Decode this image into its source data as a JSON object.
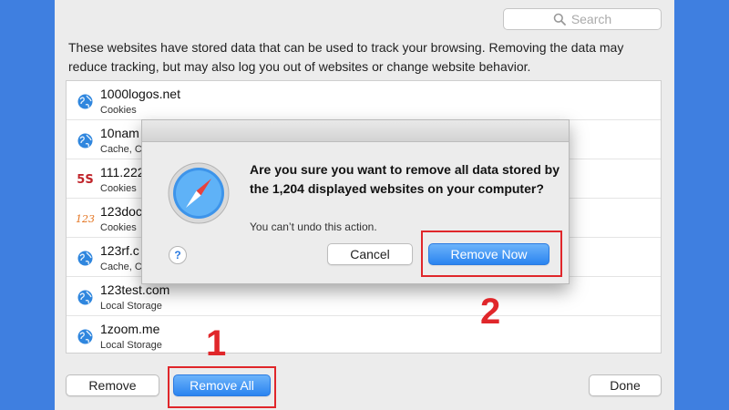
{
  "search": {
    "placeholder": "Search",
    "icon": "search-icon"
  },
  "description": "These websites have stored data that can be used to track your browsing. Removing the data may reduce tracking, but may also log you out of websites or change website behavior.",
  "websites": [
    {
      "name": "1000logos.net",
      "detail": "Cookies",
      "icon": "globe-icon"
    },
    {
      "name": "10nam",
      "detail": "Cache, C",
      "icon": "globe-icon"
    },
    {
      "name": "111.222",
      "detail": "Cookies",
      "icon": "5s-site-icon"
    },
    {
      "name": "123doc",
      "detail": "Cookies",
      "icon": "123-site-icon"
    },
    {
      "name": "123rf.c",
      "detail": "Cache, C",
      "icon": "globe-icon"
    },
    {
      "name": "123test.com",
      "detail": "Local Storage",
      "icon": "globe-icon"
    },
    {
      "name": "1zoom.me",
      "detail": "Local Storage",
      "icon": "globe-icon"
    }
  ],
  "site_icon_text": {
    "five_s": "5S",
    "one_two_three": "123"
  },
  "buttons": {
    "remove": "Remove",
    "remove_all": "Remove All",
    "done": "Done"
  },
  "dialog": {
    "title": "Are you sure you want to remove all data stored by the 1,204 displayed websites on your computer?",
    "note": "You can’t undo this action.",
    "help": "?",
    "cancel": "Cancel",
    "remove_now": "Remove Now",
    "icon": "safari-compass-icon"
  },
  "annotations": {
    "step1": "1",
    "step2": "2",
    "highlight_color": "#e0262a"
  },
  "colors": {
    "background": "#3f7fe0",
    "accent": "#2a84f0",
    "panel": "#ececec"
  }
}
